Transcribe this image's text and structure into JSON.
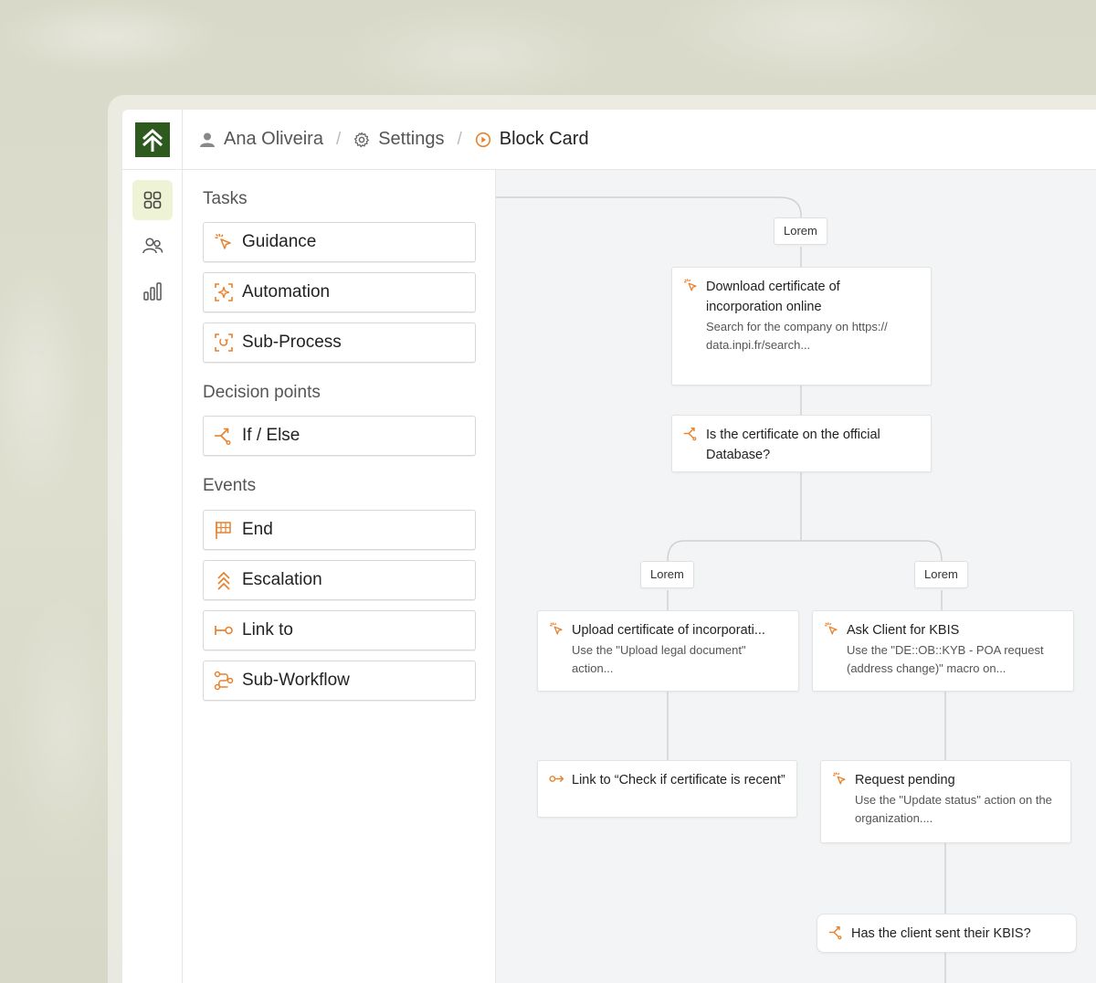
{
  "header": {
    "breadcrumb": [
      {
        "label": "Ana Oliveira",
        "icon": "user-icon"
      },
      {
        "label": "Settings",
        "icon": "gear-icon"
      },
      {
        "label": "Block Card",
        "icon": "play-circle-icon"
      }
    ],
    "separator": "/"
  },
  "rail": {
    "items": [
      {
        "icon": "grid-icon",
        "active": true
      },
      {
        "icon": "users-icon",
        "active": false
      },
      {
        "icon": "bar-chart-icon",
        "active": false
      }
    ]
  },
  "palette": {
    "sections": [
      {
        "title": "Tasks",
        "items": [
          "Guidance",
          "Automation",
          "Sub-Process"
        ]
      },
      {
        "title": "Decision points",
        "items": [
          "If / Else"
        ]
      },
      {
        "title": "Events",
        "items": [
          "End",
          "Escalation",
          "Link to",
          "Sub-Workflow"
        ]
      }
    ]
  },
  "canvas": {
    "tags": [
      "Lorem",
      "Lorem",
      "Lorem"
    ],
    "nodes": [
      {
        "title": "Download certificate of incorporation online",
        "desc": "Search for the company on https:// data.inpi.fr/search...",
        "icon": "cursor-click-icon"
      },
      {
        "title": "Is the certificate on the official Database?",
        "desc": "",
        "icon": "branch-icon"
      },
      {
        "title": "Upload certificate of incorporati...",
        "desc": "Use the \"Upload legal document\" action...",
        "icon": "cursor-click-icon"
      },
      {
        "title": "Ask Client for KBIS",
        "desc": "Use the \"DE::OB::KYB - POA request (address change)\" macro on...",
        "icon": "cursor-click-icon"
      },
      {
        "title": "Link to “Check if certificate is recent”",
        "desc": "",
        "icon": "link-icon"
      },
      {
        "title": "Request pending",
        "desc": "Use the \"Update status\" action on the organization....",
        "icon": "cursor-click-icon"
      },
      {
        "title": "Has the client sent their KBIS?",
        "desc": "",
        "icon": "branch-icon"
      }
    ]
  },
  "colors": {
    "accent": "#e8812c",
    "brand": "#2f5a1f",
    "rail_active_bg": "#eef3d6",
    "canvas_bg": "#f3f4f5"
  }
}
